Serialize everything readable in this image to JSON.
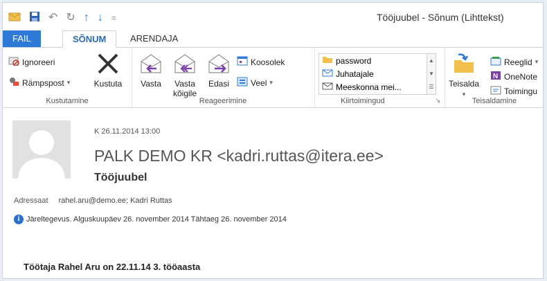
{
  "window": {
    "title": "Tööjuubel - Sõnum (Lihttekst)"
  },
  "tabs": [
    {
      "label": "FAIL"
    },
    {
      "label": "SÕNUM"
    },
    {
      "label": "ARENDAJA"
    }
  ],
  "ribbon": {
    "kustutamine": {
      "label": "Kustutamine",
      "ignore": "Ignoreeri",
      "junk": "Rämpspost",
      "delete": "Kustuta"
    },
    "reageerimine": {
      "label": "Reageerimine",
      "reply": "Vasta",
      "reply_all_1": "Vasta",
      "reply_all_2": "kõigile",
      "forward": "Edasi",
      "meeting": "Koosolek",
      "more": "Veel"
    },
    "kiirtoimingud": {
      "label": "Kiirtoimingud",
      "items": [
        "password",
        "Juhatajale",
        "Meeskonna mei..."
      ]
    },
    "teisaldamine": {
      "label": "Teisaldamine",
      "move": "Teisalda",
      "rules": "Reeglid",
      "onenote": "OneNote",
      "actions": "Toimingu"
    }
  },
  "message": {
    "date": "K 26.11.2014 13:00",
    "sender": "PALK DEMO KR <kadri.ruttas@itera.ee>",
    "subject": "Tööjuubel",
    "to_label": "Adressaat",
    "to_value": "rahel.aru@demo.ee; Kadri Ruttas",
    "followup": "Järeltegevus.  Alguskuupäev 26. november 2014  Tähtaeg 26. november 2014",
    "body": "Töötaja Rahel Aru on 22.11.14 3. tööaasta"
  },
  "colors": {
    "accent": "#2e7ad6",
    "active_tab_text": "#2b6cb7"
  }
}
